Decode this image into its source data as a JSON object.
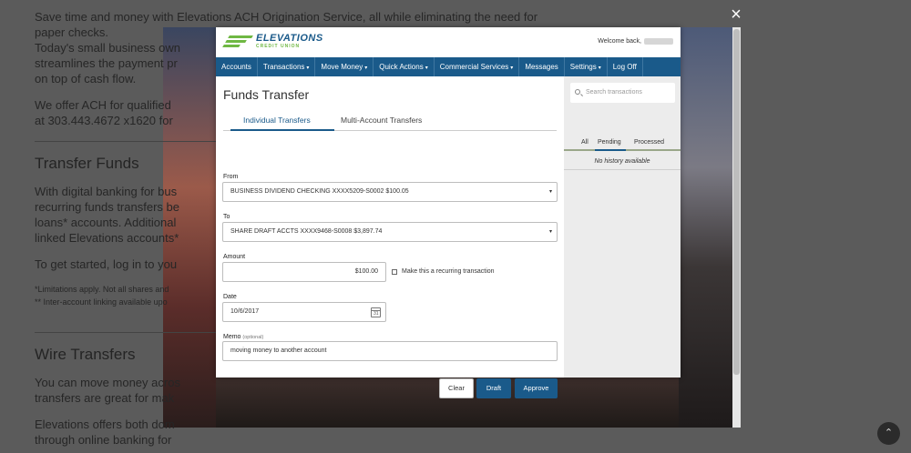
{
  "background": {
    "paragraphs": [
      "Save time and money with Elevations ACH Origination Service, all while eliminating the need for paper checks.",
      "Today's small business own",
      "streamlines the payment pr",
      "on top of cash flow.",
      "We offer ACH for qualified",
      "at 303.443.4672 x1620 for"
    ],
    "heading_transfer": "Transfer Funds",
    "transfer_lines": [
      "With digital banking for bus",
      "recurring funds transfers be",
      "loans* accounts. Additional",
      "linked Elevations accounts*"
    ],
    "get_started": "To get started, log in to you",
    "footnote1": "*Limitations apply. Not all shares and",
    "footnote2": "** Inter-account linking available upo",
    "heading_wire": "Wire Transfers",
    "wire_lines": [
      "You can move money acros",
      "transfers are great for mak"
    ],
    "wire_lines2": [
      "Elevations offers both dom",
      "through online banking for"
    ]
  },
  "modal": {
    "close_icon": "×",
    "scroll_top_icon": "⌃"
  },
  "app": {
    "logo_name": "ELEVATIONS",
    "logo_sub": "CREDIT UNION",
    "welcome": "Welcome back,",
    "nav": [
      {
        "label": "Accounts",
        "caret": ""
      },
      {
        "label": "Transactions",
        "caret": "▾"
      },
      {
        "label": "Move Money",
        "caret": "▾"
      },
      {
        "label": "Quick Actions",
        "caret": "▾"
      },
      {
        "label": "Commercial Services",
        "caret": "▾"
      },
      {
        "label": "Messages",
        "caret": ""
      },
      {
        "label": "Settings",
        "caret": "▾"
      },
      {
        "label": "Log Off",
        "caret": ""
      }
    ],
    "page_title": "Funds Transfer",
    "tabs": {
      "individual": "Individual Transfers",
      "multi": "Multi-Account Transfers"
    },
    "form": {
      "from_label": "From",
      "from_value": "BUSINESS DIVIDEND CHECKING XXXX5209-S0002 $100.05",
      "to_label": "To",
      "to_value": "SHARE DRAFT ACCTS XXXX9468-S0008 $3,897.74",
      "amount_label": "Amount",
      "amount_value": "$100.00",
      "recurring_label": "Make this a recurring transaction",
      "date_label": "Date",
      "date_value": "10/6/2017",
      "calendar_day": "31",
      "memo_label": "Memo",
      "memo_optional": "(optional)",
      "memo_value": "moving money to another account",
      "dropdown_caret": "▾"
    },
    "buttons": {
      "clear": "Clear",
      "draft": "Draft",
      "approve": "Approve"
    },
    "sidebar": {
      "search_placeholder": "Search transactions",
      "tabs": [
        "All",
        "Pending",
        "Processed"
      ],
      "no_history": "No history available"
    }
  },
  "colors": {
    "brand_blue": "#1a5a8a",
    "brand_green": "#6fb843"
  }
}
